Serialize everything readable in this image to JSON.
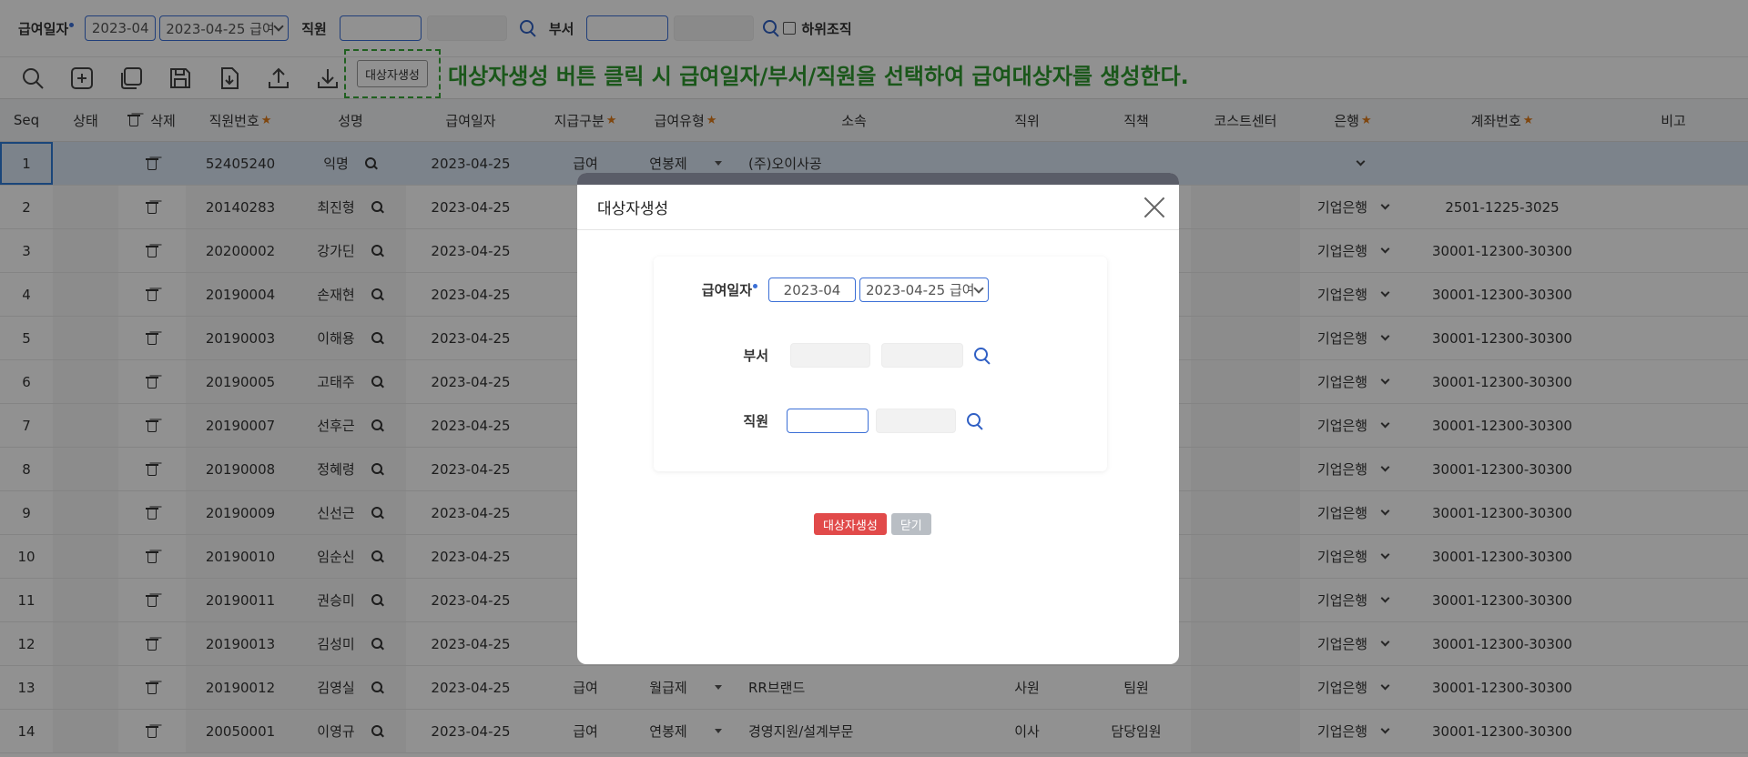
{
  "filter": {
    "pay_date_label": "급여일자",
    "pay_month": "2023-04",
    "pay_date": "2023-04-25 급여",
    "employee_label": "직원",
    "dept_label": "부서",
    "sub_org_label": "하위조직"
  },
  "toolbar": {
    "generate_label": "대상자생성",
    "annotation": "대상자생성 버튼 클릭 시 급여일자/부서/직원을 선택하여 급여대상자를 생성한다."
  },
  "grid": {
    "headers": {
      "seq": "Seq",
      "status": "상태",
      "delete": "삭제",
      "emp_no": "직원번호",
      "name": "성명",
      "pay_date": "급여일자",
      "pay_type": "지급구분",
      "salary_type": "급여유형",
      "dept": "소속",
      "position": "직위",
      "duty": "직책",
      "cost_center": "코스트센터",
      "bank": "은행",
      "account": "계좌번호",
      "note": "비고"
    },
    "rows": [
      {
        "seq": "1",
        "emp_no": "52405240",
        "name": "익명",
        "pay_date": "2023-04-25",
        "pay_type": "급여",
        "salary_type": "연봉제",
        "dept": "(주)오이사공",
        "position": "",
        "duty": "",
        "bank": "",
        "account": ""
      },
      {
        "seq": "2",
        "emp_no": "20140283",
        "name": "최진형",
        "pay_date": "2023-04-25",
        "pay_type": "",
        "salary_type": "",
        "dept": "",
        "position": "",
        "duty": "",
        "bank": "기업은행",
        "account": "2501-1225-3025"
      },
      {
        "seq": "3",
        "emp_no": "20200002",
        "name": "강가딘",
        "pay_date": "2023-04-25",
        "pay_type": "",
        "salary_type": "",
        "dept": "",
        "position": "",
        "duty": "",
        "bank": "기업은행",
        "account": "30001-12300-30300"
      },
      {
        "seq": "4",
        "emp_no": "20190004",
        "name": "손재현",
        "pay_date": "2023-04-25",
        "pay_type": "",
        "salary_type": "",
        "dept": "",
        "position": "",
        "duty": "",
        "bank": "기업은행",
        "account": "30001-12300-30300"
      },
      {
        "seq": "5",
        "emp_no": "20190003",
        "name": "이해용",
        "pay_date": "2023-04-25",
        "pay_type": "",
        "salary_type": "",
        "dept": "",
        "position": "",
        "duty": "",
        "bank": "기업은행",
        "account": "30001-12300-30300"
      },
      {
        "seq": "6",
        "emp_no": "20190005",
        "name": "고태주",
        "pay_date": "2023-04-25",
        "pay_type": "",
        "salary_type": "",
        "dept": "",
        "position": "",
        "duty": "",
        "bank": "기업은행",
        "account": "30001-12300-30300"
      },
      {
        "seq": "7",
        "emp_no": "20190007",
        "name": "선후근",
        "pay_date": "2023-04-25",
        "pay_type": "",
        "salary_type": "",
        "dept": "",
        "position": "",
        "duty": "",
        "bank": "기업은행",
        "account": "30001-12300-30300"
      },
      {
        "seq": "8",
        "emp_no": "20190008",
        "name": "정혜령",
        "pay_date": "2023-04-25",
        "pay_type": "",
        "salary_type": "",
        "dept": "",
        "position": "",
        "duty": "",
        "bank": "기업은행",
        "account": "30001-12300-30300"
      },
      {
        "seq": "9",
        "emp_no": "20190009",
        "name": "신선근",
        "pay_date": "2023-04-25",
        "pay_type": "",
        "salary_type": "",
        "dept": "",
        "position": "",
        "duty": "",
        "bank": "기업은행",
        "account": "30001-12300-30300"
      },
      {
        "seq": "10",
        "emp_no": "20190010",
        "name": "임순신",
        "pay_date": "2023-04-25",
        "pay_type": "",
        "salary_type": "",
        "dept": "",
        "position": "",
        "duty": "",
        "bank": "기업은행",
        "account": "30001-12300-30300"
      },
      {
        "seq": "11",
        "emp_no": "20190011",
        "name": "권승미",
        "pay_date": "2023-04-25",
        "pay_type": "",
        "salary_type": "",
        "dept": "",
        "position": "",
        "duty": "",
        "bank": "기업은행",
        "account": "30001-12300-30300"
      },
      {
        "seq": "12",
        "emp_no": "20190013",
        "name": "김성미",
        "pay_date": "2023-04-25",
        "pay_type": "",
        "salary_type": "",
        "dept": "",
        "position": "",
        "duty": "",
        "bank": "기업은행",
        "account": "30001-12300-30300"
      },
      {
        "seq": "13",
        "emp_no": "20190012",
        "name": "김영실",
        "pay_date": "2023-04-25",
        "pay_type": "급여",
        "salary_type": "월급제",
        "dept": "RR브랜드",
        "position": "사원",
        "duty": "팀원",
        "bank": "기업은행",
        "account": "30001-12300-30300"
      },
      {
        "seq": "14",
        "emp_no": "20050001",
        "name": "이영규",
        "pay_date": "2023-04-25",
        "pay_type": "급여",
        "salary_type": "연봉제",
        "dept": "경영지원/설계부문",
        "position": "이사",
        "duty": "담당임원",
        "bank": "기업은행",
        "account": "30001-12300-30300"
      }
    ]
  },
  "modal": {
    "title": "대상자생성",
    "pay_date_label": "급여일자",
    "pay_month": "2023-04",
    "pay_date": "2023-04-25 급여",
    "dept_label": "부서",
    "employee_label": "직원",
    "generate_button": "대상자생성",
    "close_button": "닫기"
  },
  "colors": {
    "accent": "#3b6fd6",
    "annotation": "#2f9a2f",
    "danger": "#e14a4a"
  }
}
